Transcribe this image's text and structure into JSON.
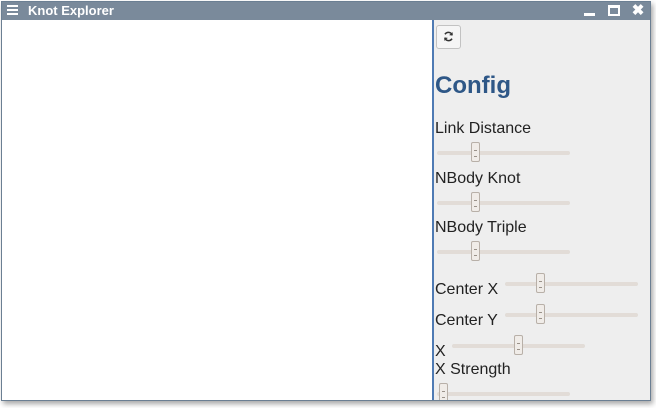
{
  "window": {
    "title": "Knot Explorer"
  },
  "icons": {
    "menu": "hamburger-icon",
    "minimize": "minimize-icon",
    "maximize": "maximize-icon",
    "close": "close-icon",
    "refresh": "refresh-icon"
  },
  "colors": {
    "titlebar": "#7a8a9b",
    "panel_bg": "#eeeeee",
    "panel_border": "#4f7bb4",
    "heading": "#2e5787"
  },
  "panel": {
    "heading": "Config",
    "controls": [
      {
        "label": "Link Distance",
        "value": 0.29
      },
      {
        "label": "NBody Knot",
        "value": 0.29
      },
      {
        "label": "NBody Triple",
        "value": 0.29
      },
      {
        "label": "Center X",
        "value": 0.27
      },
      {
        "label": "Center Y",
        "value": 0.27
      },
      {
        "label": "X",
        "value": 0.5
      },
      {
        "label": "X Strength",
        "value": 0.05
      }
    ]
  },
  "window_controls": {
    "close_glyph": "✖"
  }
}
